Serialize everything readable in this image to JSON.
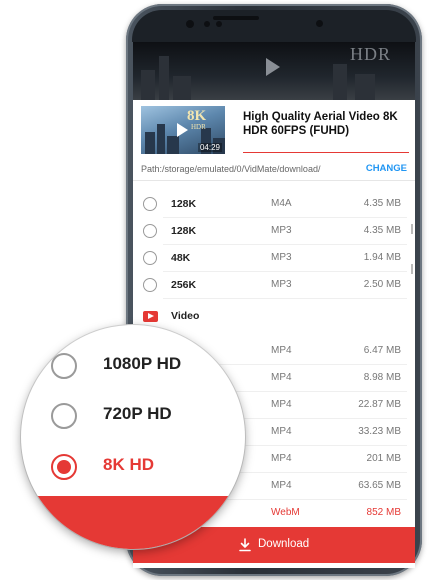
{
  "video": {
    "title": "High Quality Aerial Video 8K HDR 60FPS (FUHD)",
    "duration": "04:29",
    "thumb_badge": "8K",
    "thumb_badge_sub": "HDR",
    "header_watermark": "HDR"
  },
  "path": {
    "text": "Path:/storage/emulated/0/VidMate/download/",
    "change_label": "CHANGE"
  },
  "audio_rows": [
    {
      "quality": "128K",
      "format": "M4A",
      "size": "4.35 MB"
    },
    {
      "quality": "128K",
      "format": "MP3",
      "size": "4.35 MB"
    },
    {
      "quality": "48K",
      "format": "MP3",
      "size": "1.94 MB"
    },
    {
      "quality": "256K",
      "format": "MP3",
      "size": "2.50 MB"
    }
  ],
  "video_section": {
    "label": "Video"
  },
  "video_rows": [
    {
      "format": "MP4",
      "size": "6.47 MB"
    },
    {
      "format": "MP4",
      "size": "8.98 MB"
    },
    {
      "format": "MP4",
      "size": "22.87 MB"
    },
    {
      "format": "MP4",
      "size": "33.23 MB"
    },
    {
      "format": "MP4",
      "size": "201 MB"
    },
    {
      "format": "MP4",
      "size": "63.65 MB"
    },
    {
      "format": "WebM",
      "size": "852 MB"
    }
  ],
  "magnifier": {
    "options": [
      {
        "label": "1080P HD",
        "selected": false
      },
      {
        "label": "720P HD",
        "selected": false
      },
      {
        "label": "8K HD",
        "selected": true
      }
    ]
  },
  "download": {
    "label": "Download"
  },
  "colors": {
    "accent": "#e53935",
    "link": "#2196f3"
  }
}
